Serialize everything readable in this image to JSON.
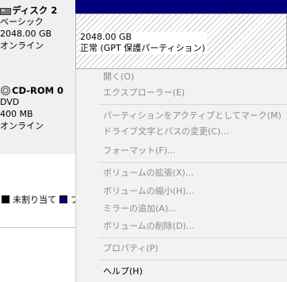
{
  "disks": [
    {
      "icon": "hard-disk-icon",
      "name": "ディスク 2",
      "type": "ベーシック",
      "size": "2048.00 GB",
      "status": "オンライン"
    },
    {
      "icon": "cd-rom-icon",
      "name": "CD-ROM 0",
      "type": "DVD",
      "size": "400 MB",
      "status": "オンライン"
    }
  ],
  "partition": {
    "size": "2048.00 GB",
    "status": "正常 (GPT 保護パーティション)"
  },
  "legend": {
    "unallocated": "未割り当て",
    "primary_partial": "プ"
  },
  "context_menu": {
    "open": "開く(O)",
    "explore": "エクスプローラー(E)",
    "mark_active": "パーティションをアクティブとしてマーク(M)",
    "change_drive_letter": "ドライブ文字とパスの変更(C)...",
    "format": "フォーマット(F)...",
    "extend": "ボリュームの拡張(X)...",
    "shrink": "ボリュームの縮小(H)...",
    "add_mirror": "ミラーの追加(A)...",
    "delete": "ボリュームの削除(D)...",
    "properties": "プロパティ(P)",
    "help": "ヘルプ(H)"
  },
  "colors": {
    "partition_header": "#00007b",
    "menu_background": "#f2f2f2",
    "disabled_text": "#8c8c8c"
  }
}
